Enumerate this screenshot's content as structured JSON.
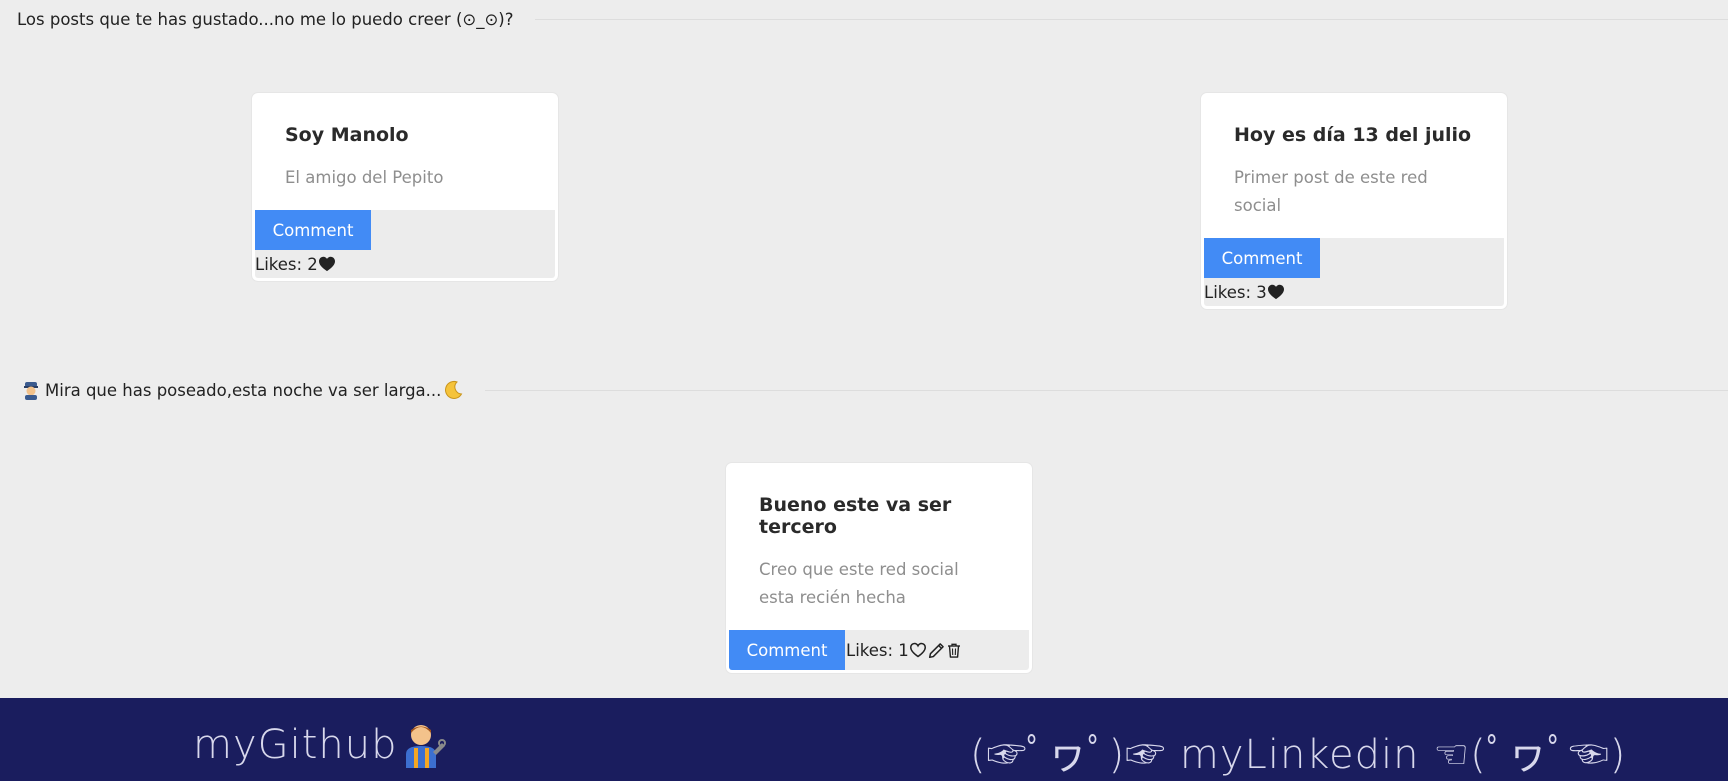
{
  "sections": {
    "liked_heading": "Los posts que te has gustado...no me lo puedo creer (⊙_⊙)?",
    "owned_heading": "Mira que has poseado,esta noche va ser larga...",
    "owned_heading_prefix_icon": "guard-emoji",
    "owned_heading_suffix_icon": "moon-emoji"
  },
  "liked_posts": [
    {
      "title": "Soy Manolo",
      "text": "El amigo del Pepito",
      "comment_label": "Comment",
      "likes_label": "Likes: 2",
      "like_icon": "filled-heart-icon"
    },
    {
      "title": "Hoy es día 13 del julio",
      "text": "Primer post de este red social",
      "comment_label": "Comment",
      "likes_label": "Likes: 3",
      "like_icon": "filled-heart-icon"
    }
  ],
  "owned_posts": [
    {
      "title": "Bueno este va ser tercero",
      "text": "Creo que este red social esta recién hecha",
      "comment_label": "Comment",
      "likes_label": "Likes: 1",
      "like_icon": "outline-heart-icon",
      "edit_icon": "pencil-icon",
      "delete_icon": "trash-icon"
    }
  ],
  "footer": {
    "github_label": "myGithub",
    "github_icon": "mechanic-emoji",
    "linkedin_label": "(☞ﾟヮﾟ)☞ myLinkedin ☜(ﾟヮﾟ☜)"
  },
  "colors": {
    "background": "#ededed",
    "accent_button": "#428bf5",
    "footer_background": "#1a1d5e",
    "footer_text": "#d8d8ec"
  }
}
